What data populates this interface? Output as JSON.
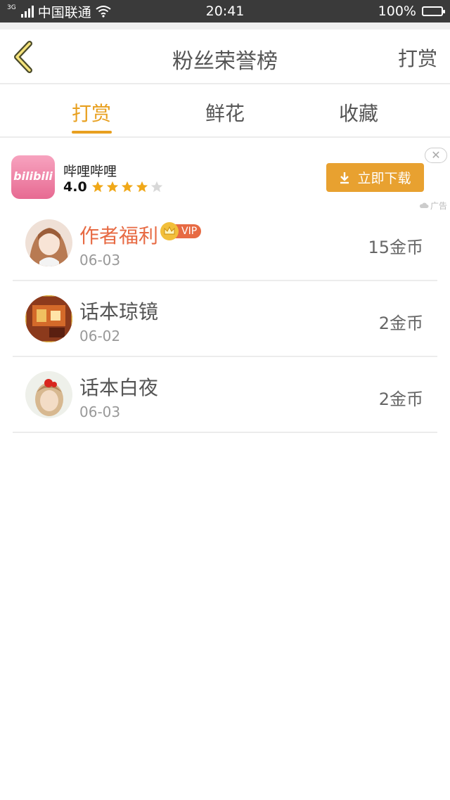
{
  "status_bar": {
    "network": "3G",
    "carrier": "中国联通",
    "time": "20:41",
    "battery": "100%"
  },
  "header": {
    "title": "粉丝荣誉榜",
    "right_action": "打赏"
  },
  "tabs": [
    {
      "label": "打赏",
      "active": true
    },
    {
      "label": "鲜花",
      "active": false
    },
    {
      "label": "收藏",
      "active": false
    }
  ],
  "ad": {
    "logo_text": "bilibili",
    "app_name": "哔哩哔哩",
    "rating": "4.0",
    "stars_filled": 4,
    "stars_total": 5,
    "button_label": "立即下载",
    "close_label": "✕",
    "ad_label": "广告"
  },
  "list": [
    {
      "name": "作者福利",
      "vip": true,
      "vip_label": "VIP",
      "date": "06-03",
      "amount": "15金币"
    },
    {
      "name": "话本琼镜",
      "vip": false,
      "date": "06-02",
      "amount": "2金币"
    },
    {
      "name": "话本白夜",
      "vip": false,
      "date": "06-03",
      "amount": "2金币"
    }
  ],
  "colors": {
    "accent": "#e8a020",
    "vip_name": "#e76a43",
    "status_bar": "#3a3a3a"
  }
}
